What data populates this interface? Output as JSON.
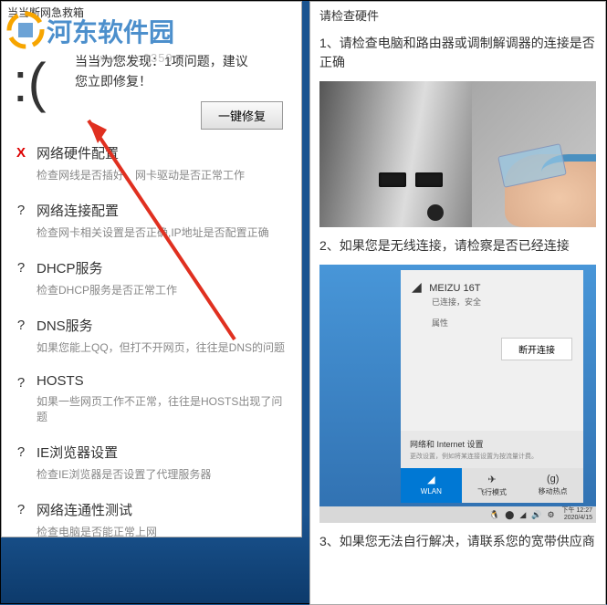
{
  "watermark": {
    "text": "河东软件园",
    "url": "www.pc0359.cn"
  },
  "left": {
    "title": "当当断网急救箱",
    "header_line1": "当当为您发现：1项问题，建议",
    "header_line2": "您立即修复！",
    "fix_button": "一键修复",
    "items": [
      {
        "status": "X",
        "status_class": "status-x",
        "title": "网络硬件配置",
        "desc": "检查网线是否插好，网卡驱动是否正常工作"
      },
      {
        "status": "?",
        "status_class": "status-q",
        "title": "网络连接配置",
        "desc": "检查网卡相关设置是否正确,IP地址是否配置正确"
      },
      {
        "status": "?",
        "status_class": "status-q",
        "title": "DHCP服务",
        "desc": "检查DHCP服务是否正常工作"
      },
      {
        "status": "?",
        "status_class": "status-q",
        "title": "DNS服务",
        "desc": "如果您能上QQ，但打不开网页，往往是DNS的问题"
      },
      {
        "status": "?",
        "status_class": "status-q",
        "title": "HOSTS",
        "desc": "如果一些网页工作不正常，往往是HOSTS出现了问题"
      },
      {
        "status": "?",
        "status_class": "status-q",
        "title": "IE浏览器设置",
        "desc": "检查IE浏览器是否设置了代理服务器"
      },
      {
        "status": "?",
        "status_class": "status-q",
        "title": "网络连通性测试",
        "desc": "检查电脑是否能正常上网"
      }
    ]
  },
  "right": {
    "title": "请检查硬件",
    "item1": "1、请检查电脑和路由器或调制解调器的连接是否正确",
    "item2": "2、如果您是无线连接，请检察是否已经连接",
    "item3": "3、如果您无法自行解决，请联系您的宽带供应商",
    "wifi": {
      "name": "MEIZU 16T",
      "status": "已连接，安全",
      "prop": "属性",
      "disconnect": "断开连接",
      "settings_title": "网络和 Internet 设置",
      "settings_sub": "更改设置，例如将某连接设置为按流量计费。",
      "tab1": "WLAN",
      "tab2": "飞行模式",
      "tab3": "移动热点",
      "time": "下午 12:27",
      "date": "2020/4/15"
    }
  }
}
